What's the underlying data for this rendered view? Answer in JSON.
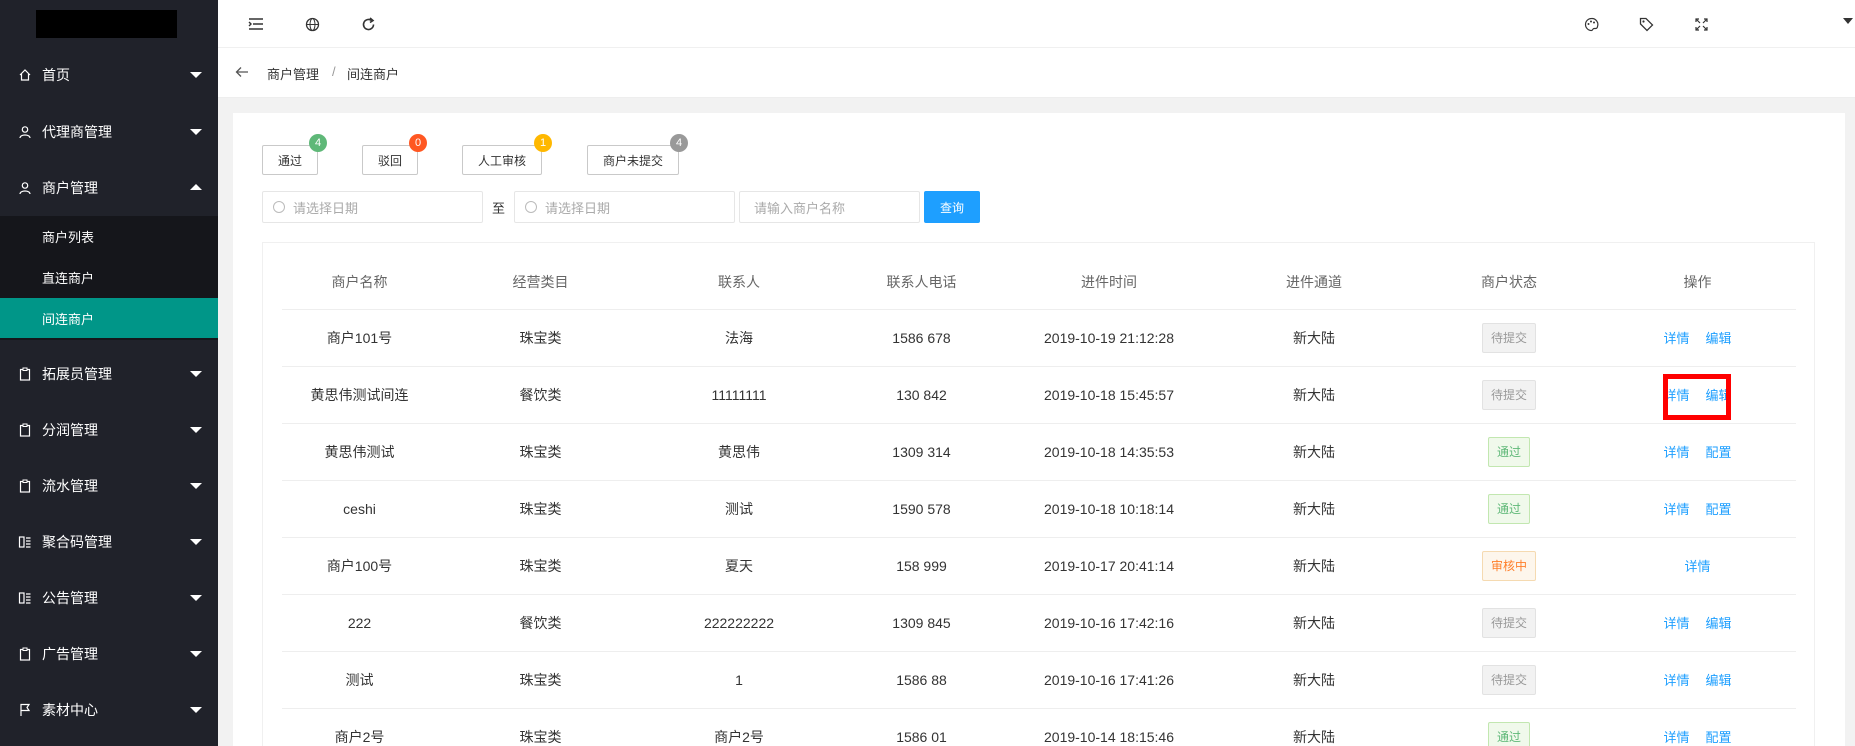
{
  "sidebar": {
    "menu": [
      {
        "label": "首页",
        "icon": "home-icon"
      },
      {
        "label": "代理商管理",
        "icon": "user-icon"
      },
      {
        "label": "商户管理",
        "icon": "user-icon"
      },
      {
        "label": "拓展员管理",
        "icon": "clipboard-icon"
      },
      {
        "label": "分润管理",
        "icon": "clipboard-icon"
      },
      {
        "label": "流水管理",
        "icon": "clipboard-icon"
      },
      {
        "label": "聚合码管理",
        "icon": "grid-icon"
      },
      {
        "label": "公告管理",
        "icon": "grid-icon"
      },
      {
        "label": "广告管理",
        "icon": "clipboard-icon"
      },
      {
        "label": "素材中心",
        "icon": "flag-icon"
      }
    ],
    "submenu": [
      "商户列表",
      "直连商户",
      "间连商户"
    ]
  },
  "header": {
    "icons": [
      "menu-toggle-icon",
      "globe-icon",
      "refresh-icon",
      "palette-icon",
      "tag-icon",
      "fullscreen-icon"
    ]
  },
  "breadcrumb": {
    "parent": "商户管理",
    "separator": "/",
    "current": "间连商户"
  },
  "filters": {
    "status_buttons": [
      {
        "label": "通过",
        "count": "4",
        "color": "#5fb878"
      },
      {
        "label": "驳回",
        "count": "0",
        "color": "#ff5722"
      },
      {
        "label": "人工审核",
        "count": "1",
        "color": "#ffb800"
      },
      {
        "label": "商户未提交",
        "count": "4",
        "color": "#999999"
      }
    ],
    "start_date_placeholder": "请选择日期",
    "to_label": "至",
    "end_date_placeholder": "请选择日期",
    "merchant_name_placeholder": "请输入商户名称",
    "query_label": "查询"
  },
  "table": {
    "columns": [
      "商户名称",
      "经营类目",
      "联系人",
      "联系人电话",
      "进件时间",
      "进件通道",
      "商户状态",
      "操作"
    ],
    "rows": [
      {
        "name": "商户101号",
        "category": "珠宝类",
        "contact": "法海",
        "phone": "1586   678",
        "time": "2019-10-19 21:12:28",
        "channel": "新大陆",
        "status": "待提交",
        "ops": [
          "详情",
          "编辑"
        ]
      },
      {
        "name": "黄思伟测试间连",
        "category": "餐饮类",
        "contact": "11111111",
        "phone": "130   842",
        "time": "2019-10-18 15:45:57",
        "channel": "新大陆",
        "status": "待提交",
        "ops": [
          "详情",
          "编辑"
        ]
      },
      {
        "name": "黄思伟测试",
        "category": "珠宝类",
        "contact": "黄思伟",
        "phone": "1309   314",
        "time": "2019-10-18 14:35:53",
        "channel": "新大陆",
        "status": "通过",
        "ops": [
          "详情",
          "配置"
        ]
      },
      {
        "name": "ceshi",
        "category": "珠宝类",
        "contact": "测试",
        "phone": "1590   578",
        "time": "2019-10-18 10:18:14",
        "channel": "新大陆",
        "status": "通过",
        "ops": [
          "详情",
          "配置"
        ]
      },
      {
        "name": "商户100号",
        "category": "珠宝类",
        "contact": "夏天",
        "phone": "158   999",
        "time": "2019-10-17 20:41:14",
        "channel": "新大陆",
        "status": "审核中",
        "ops": [
          "详情"
        ]
      },
      {
        "name": "222",
        "category": "餐饮类",
        "contact": "222222222",
        "phone": "1309   845",
        "time": "2019-10-16 17:42:16",
        "channel": "新大陆",
        "status": "待提交",
        "ops": [
          "详情",
          "编辑"
        ]
      },
      {
        "name": "测试",
        "category": "珠宝类",
        "contact": "1",
        "phone": "1586   88",
        "time": "2019-10-16 17:41:26",
        "channel": "新大陆",
        "status": "待提交",
        "ops": [
          "详情",
          "编辑"
        ]
      },
      {
        "name": "商户2号",
        "category": "珠宝类",
        "contact": "商户2号",
        "phone": "1586   01",
        "time": "2019-10-14 18:15:46",
        "channel": "新大陆",
        "status": "通过",
        "ops": [
          "详情",
          "配置"
        ]
      }
    ]
  }
}
